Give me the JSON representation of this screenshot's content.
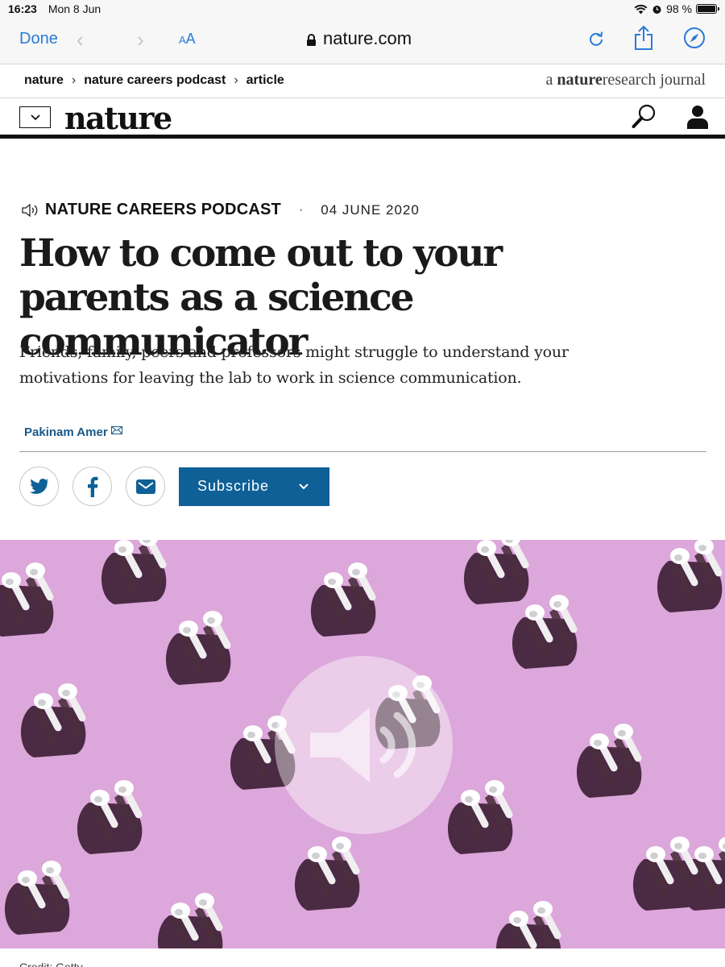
{
  "status_bar": {
    "time": "16:23",
    "date": "Mon 8 Jun",
    "battery": "98 %",
    "battery_level": 0.98
  },
  "browser": {
    "done_label": "Done",
    "text_size_label_small": "A",
    "text_size_label_large": "A",
    "url": "nature.com"
  },
  "breadcrumb": {
    "items": [
      "nature",
      "nature careers podcast",
      "article"
    ],
    "journal_prefix": "a ",
    "journal_brand_bold": "nature",
    "journal_brand_rest": "research",
    "journal_suffix": " journal"
  },
  "site": {
    "logo": "nature"
  },
  "article": {
    "kicker": "NATURE CAREERS PODCAST",
    "separator": "·",
    "date": "04 JUNE 2020",
    "headline": "How to come out to your parents as a science communicator",
    "standfirst": "Friends, family, peers and professors might struggle to understand your motivations for leaving the lab to work in science communication.",
    "author": "Pakinam Amer",
    "subscribe_label": "Subscribe",
    "image_credit": "Credit: Getty"
  },
  "colors": {
    "link_blue": "#2a7bd8",
    "brand_blue": "#0e6096",
    "hero_pink": "#dca7da",
    "author_blue": "#1a5a8a"
  },
  "icons": [
    "lock-icon",
    "reload-icon",
    "share-icon",
    "compass-icon",
    "search-icon",
    "user-icon",
    "speaker-icon",
    "mail-icon",
    "twitter-icon",
    "facebook-icon",
    "chevron-down-icon"
  ]
}
